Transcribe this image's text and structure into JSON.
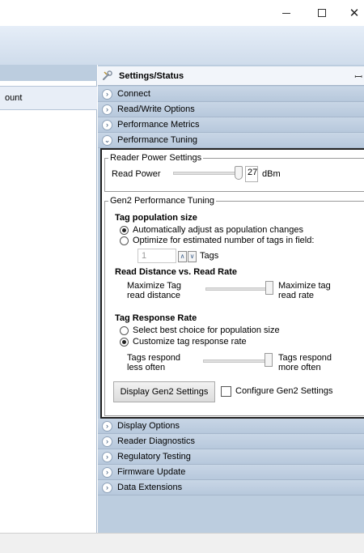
{
  "window": {
    "minimize": "–",
    "maximize": "☐",
    "close": "✕"
  },
  "left_panel": {
    "column_header": "ount"
  },
  "settings": {
    "title": "Settings/Status",
    "pin_glyph": "ꟷ",
    "sections_top": [
      {
        "label": "Connect",
        "chevron": "›"
      },
      {
        "label": "Read/Write Options",
        "chevron": "›"
      },
      {
        "label": "Performance Metrics",
        "chevron": "›"
      },
      {
        "label": "Performance Tuning",
        "chevron": "⌄"
      }
    ],
    "sections_bottom": [
      {
        "label": "Display Options",
        "chevron": "›"
      },
      {
        "label": "Reader Diagnostics",
        "chevron": "›"
      },
      {
        "label": "Regulatory Testing",
        "chevron": "›"
      },
      {
        "label": "Firmware Update",
        "chevron": "›"
      },
      {
        "label": "Data Extensions",
        "chevron": "›"
      }
    ]
  },
  "reader_power": {
    "group_title": "Reader Power Settings",
    "label": "Read Power",
    "value": "27",
    "unit": "dBm",
    "slider_fraction": 1.0
  },
  "gen2": {
    "group_title": "Gen2 Performance Tuning",
    "tag_population": {
      "heading": "Tag population size",
      "option_auto": "Automatically adjust as population changes",
      "option_optimize": "Optimize for estimated number of tags in field:",
      "selected": "auto",
      "count_value": "1",
      "spin_up": "∧",
      "spin_down": "∨",
      "count_unit": "Tags"
    },
    "distance_rate": {
      "heading": "Read Distance vs. Read Rate",
      "left_line1": "Maximize Tag",
      "left_line2": "read distance",
      "right_line1": "Maximize tag",
      "right_line2": "read rate",
      "slider_fraction": 1.0
    },
    "response_rate": {
      "heading": "Tag Response Rate",
      "option_best": "Select best choice for population size",
      "option_custom": "Customize tag response rate",
      "selected": "custom",
      "left_line1": "Tags respond",
      "left_line2": "less often",
      "right_line1": "Tags respond",
      "right_line2": "more often",
      "slider_fraction": 1.0
    },
    "display_button": "Display Gen2 Settings",
    "configure_label": "Configure Gen2 Settings",
    "configure_checked": false
  }
}
